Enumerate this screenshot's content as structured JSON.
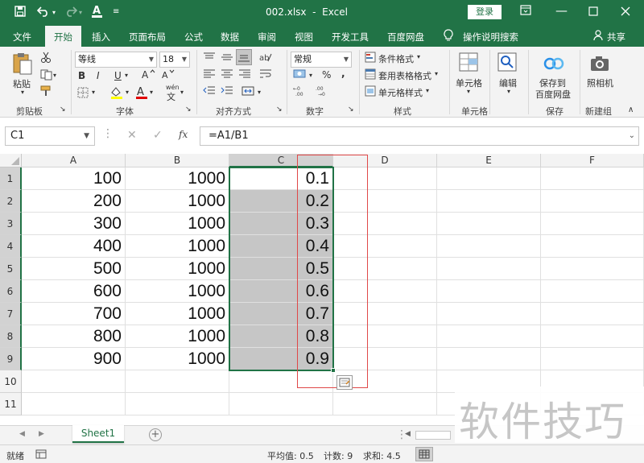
{
  "titlebar": {
    "filename": "002.xlsx",
    "sep": "-",
    "app": "Excel",
    "login": "登录"
  },
  "menu": [
    "文件",
    "开始",
    "插入",
    "页面布局",
    "公式",
    "数据",
    "审阅",
    "视图",
    "开发工具",
    "百度网盘",
    "操作说明搜索",
    "共享"
  ],
  "ribbon": {
    "paste": "粘贴",
    "clipboard": "剪贴板",
    "font_name": "等线",
    "font_size": "18",
    "font_group": "字体",
    "align_group": "对齐方式",
    "number_format": "常规",
    "number_group": "数字",
    "cond_format": "条件格式",
    "table_format": "套用表格格式",
    "cell_style": "单元格样式",
    "style_group": "样式",
    "cells": "单元格",
    "edit": "编辑",
    "save_to": "保存到",
    "baidu_pan": "百度网盘",
    "save_group": "保存",
    "camera": "照相机",
    "new_group": "新建组",
    "bold": "B",
    "italic": "I",
    "underline": "U",
    "percent": "%",
    "comma": ",",
    "wen": "wén"
  },
  "formula": {
    "namebox": "C1",
    "fx": "fx",
    "content": "=A1/B1"
  },
  "columns": [
    "A",
    "B",
    "C",
    "D",
    "E",
    "F"
  ],
  "rows": [
    "1",
    "2",
    "3",
    "4",
    "5",
    "6",
    "7",
    "8",
    "9",
    "10",
    "11"
  ],
  "cells": {
    "A": [
      "100",
      "200",
      "300",
      "400",
      "500",
      "600",
      "700",
      "800",
      "900"
    ],
    "B": [
      "1000",
      "1000",
      "1000",
      "1000",
      "1000",
      "1000",
      "1000",
      "1000",
      "1000"
    ],
    "C": [
      "0.1",
      "0.2",
      "0.3",
      "0.4",
      "0.5",
      "0.6",
      "0.7",
      "0.8",
      "0.9"
    ]
  },
  "sheets": {
    "active": "Sheet1"
  },
  "status": {
    "ready": "就绪",
    "average": "平均值: 0.5",
    "count": "计数: 9",
    "sum": "求和: 4.5"
  },
  "watermark": "软件技巧",
  "colors": {
    "excel_green": "#217346",
    "selection_gray": "#c6c6c6",
    "annotation_red": "#e04848"
  }
}
